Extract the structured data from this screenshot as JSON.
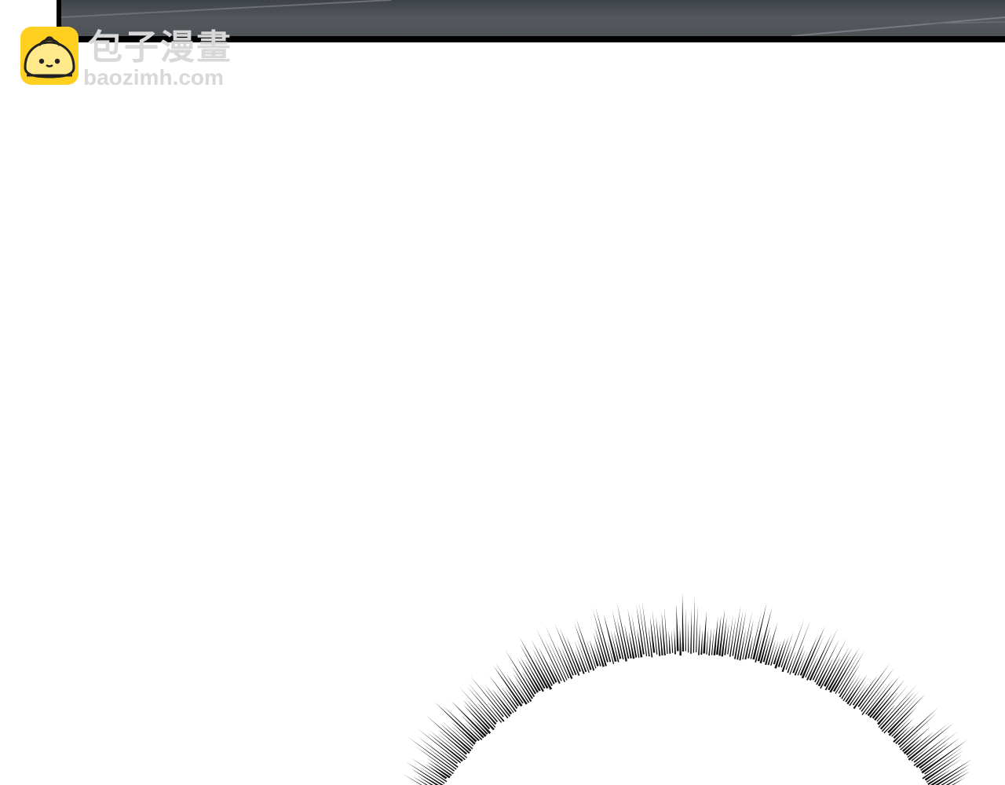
{
  "watermark": {
    "title": "包子漫畫",
    "url": "baozimh.com",
    "icon": "bun-mascot-icon",
    "icon_color": "#ffd01f",
    "text_color": "#d8d8d8"
  },
  "panel": {
    "top_panel_color": "#4d5257",
    "border_color": "#000000"
  },
  "effect": {
    "icon": "speed-lines-burst",
    "color": "#111111"
  }
}
